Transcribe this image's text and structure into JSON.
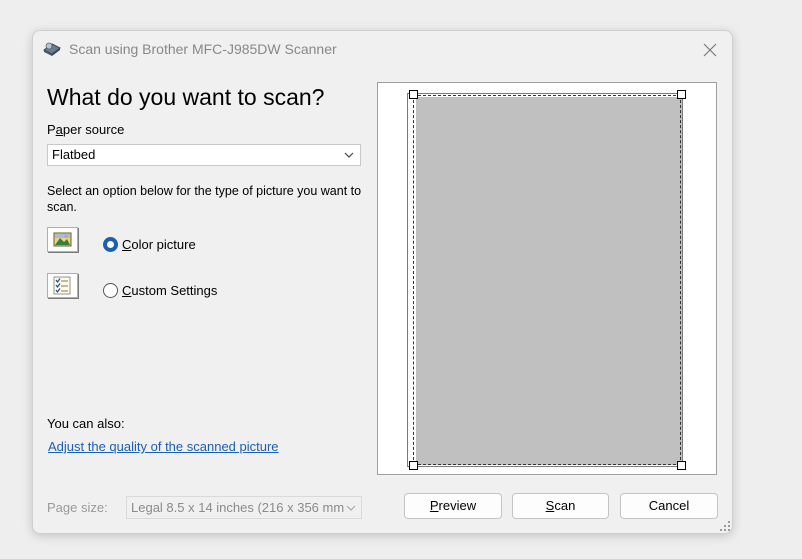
{
  "window": {
    "title": "Scan using Brother MFC-J985DW Scanner"
  },
  "heading": "What do you want to scan?",
  "paper_source": {
    "label_pre": "P",
    "label_accel": "a",
    "label_post": "per source",
    "value": "Flatbed"
  },
  "description": "Select an option below for the type of picture you want to scan.",
  "options": [
    {
      "accel": "C",
      "rest": "olor picture",
      "checked": true,
      "icon": "color-picture-icon"
    },
    {
      "accel": "C",
      "rest": "ustom Settings",
      "checked": false,
      "icon": "custom-settings-icon"
    }
  ],
  "also_label": "You can also:",
  "adjust_link": "Adjust the quality of the scanned picture",
  "page_size": {
    "label": "Page size:",
    "value": "Legal 8.5 x 14 inches (216 x 356 mm"
  },
  "buttons": {
    "preview_accel": "P",
    "preview_rest": "review",
    "scan_accel": "S",
    "scan_rest": "can",
    "cancel": "Cancel"
  },
  "colors": {
    "accent": "#1a5fb4",
    "scan_region": "#c0c0c0"
  }
}
